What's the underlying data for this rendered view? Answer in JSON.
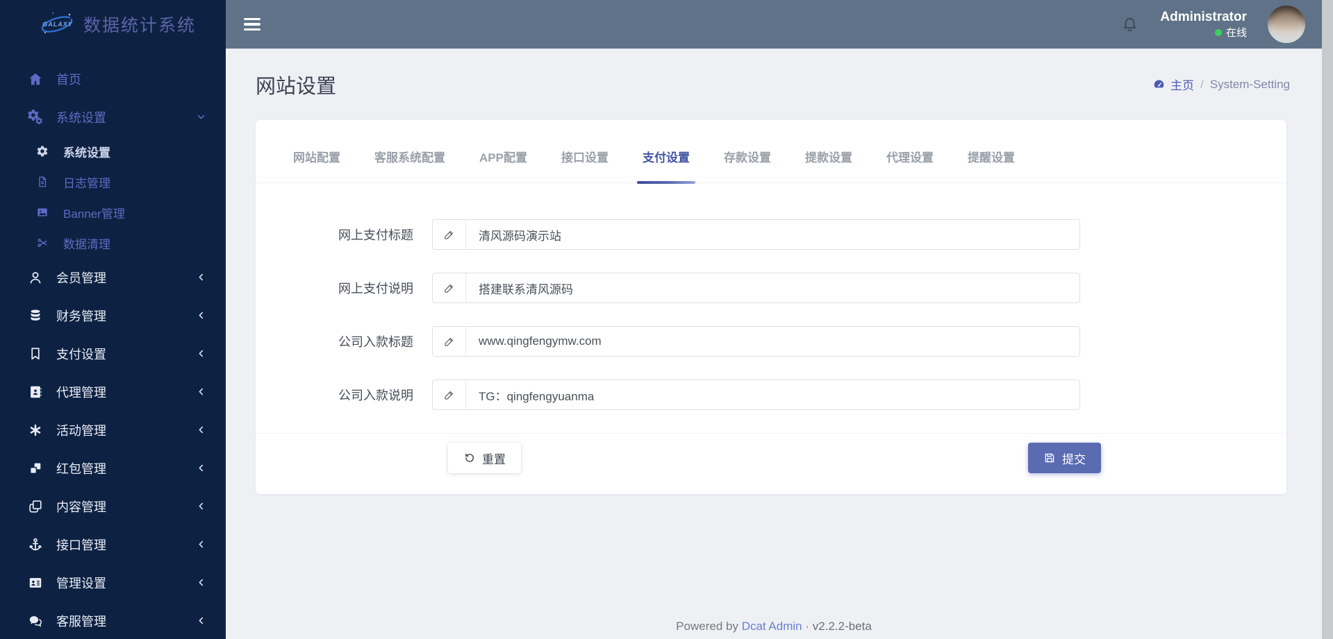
{
  "brand": {
    "logo_text": "GALAXY",
    "app_title": "数据统计系统"
  },
  "topbar": {
    "user_name": "Administrator",
    "user_status": "在线"
  },
  "sidebar": {
    "items": [
      {
        "key": "home",
        "label": "首页",
        "icon": "home",
        "level": 1,
        "tone": "indigo"
      },
      {
        "key": "system-settings",
        "label": "系统设置",
        "icon": "cogs",
        "level": 1,
        "tone": "indigo",
        "chevron": "down"
      },
      {
        "key": "system-setting",
        "label": "系统设置",
        "icon": "cog",
        "level": 2,
        "tone": "active"
      },
      {
        "key": "log-manage",
        "label": "日志管理",
        "icon": "file",
        "level": 2,
        "tone": "indigo"
      },
      {
        "key": "banner-manage",
        "label": "Banner管理",
        "icon": "image",
        "level": 2,
        "tone": "indigo"
      },
      {
        "key": "data-clean",
        "label": "数据清理",
        "icon": "scissors",
        "level": 2,
        "tone": "indigo"
      },
      {
        "key": "member-manage",
        "label": "会员管理",
        "icon": "user",
        "level": 1,
        "chevron": "left"
      },
      {
        "key": "finance-manage",
        "label": "财务管理",
        "icon": "database",
        "level": 1,
        "chevron": "left"
      },
      {
        "key": "payment-setting",
        "label": "支付设置",
        "icon": "bookmark",
        "level": 1,
        "chevron": "left"
      },
      {
        "key": "agent-manage",
        "label": "代理管理",
        "icon": "address-book",
        "level": 1,
        "chevron": "left"
      },
      {
        "key": "activity-manage",
        "label": "活动管理",
        "icon": "activity",
        "level": 1,
        "chevron": "left"
      },
      {
        "key": "redpacket-manage",
        "label": "红包管理",
        "icon": "boxes",
        "level": 1,
        "chevron": "left"
      },
      {
        "key": "content-manage",
        "label": "内容管理",
        "icon": "clone",
        "level": 1,
        "chevron": "left"
      },
      {
        "key": "api-manage",
        "label": "接口管理",
        "icon": "anchor",
        "level": 1,
        "chevron": "left"
      },
      {
        "key": "admin-setting",
        "label": "管理设置",
        "icon": "id-card",
        "level": 1,
        "chevron": "left"
      },
      {
        "key": "service-manage",
        "label": "客服管理",
        "icon": "comments",
        "level": 1,
        "chevron": "left"
      }
    ]
  },
  "page": {
    "title": "网站设置",
    "breadcrumb": {
      "home_label": "主页",
      "divider": "/",
      "current": "System-Setting"
    }
  },
  "tabs": [
    {
      "key": "website",
      "label": "网站配置"
    },
    {
      "key": "service-system",
      "label": "客服系统配置"
    },
    {
      "key": "app",
      "label": "APP配置"
    },
    {
      "key": "interface",
      "label": "接口设置"
    },
    {
      "key": "payment",
      "label": "支付设置",
      "active": true
    },
    {
      "key": "deposit",
      "label": "存款设置"
    },
    {
      "key": "withdraw",
      "label": "提款设置"
    },
    {
      "key": "agent",
      "label": "代理设置"
    },
    {
      "key": "remind",
      "label": "提醒设置"
    }
  ],
  "form": {
    "fields": [
      {
        "key": "online-pay-title",
        "label": "网上支付标题",
        "value": "清风源码演示站"
      },
      {
        "key": "online-pay-desc",
        "label": "网上支付说明",
        "value": "搭建联系清风源码"
      },
      {
        "key": "company-in-title",
        "label": "公司入款标题",
        "value": "www.qingfengymw.com"
      },
      {
        "key": "company-in-desc",
        "label": "公司入款说明",
        "value": "TG：qingfengyuanma"
      }
    ],
    "reset_label": "重置",
    "submit_label": "提交"
  },
  "footer": {
    "powered": "Powered by",
    "link_label": "Dcat Admin",
    "separator": "·",
    "version": "v2.2.2-beta"
  },
  "colors": {
    "sidebar-bg": "#0d2242",
    "topbar-bg": "#5f7287",
    "page-bg": "#eef0f4",
    "accent": "#5a6bb2",
    "tab-active": "#4154a2",
    "link": "#4d5cb5",
    "menu-indigo": "#5d6bc4",
    "status-green": "#3ecf5e"
  }
}
